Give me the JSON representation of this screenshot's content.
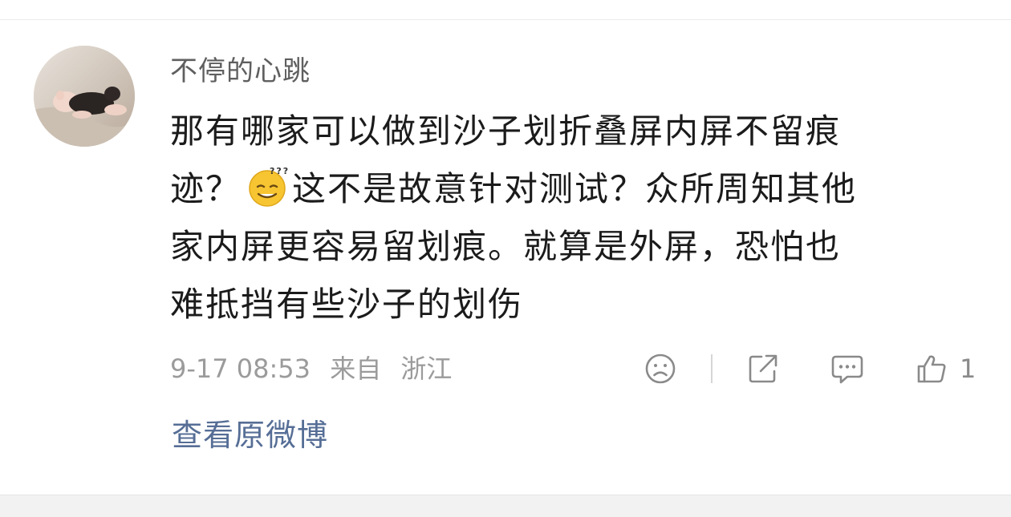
{
  "comment": {
    "username": "不停的心跳",
    "content_lines": {
      "line1": "那有哪家可以做到沙子划折叠屏内屏不留痕",
      "line2_pre": "迹？",
      "line2_post": "这不是故意针对测试？众所周知其他",
      "line3": "家内屏更容易留划痕。就算是外屏，恐怕也",
      "line4": "难抵挡有些沙子的划伤"
    },
    "emoji": "thinking-sleepy-emoji",
    "timestamp": "9-17 08:53",
    "source_prefix": "来自",
    "location": "浙江",
    "like_count": "1"
  },
  "actions": {
    "dislike_icon": "sad-face-icon",
    "share_icon": "share-icon",
    "comment_icon": "comment-icon",
    "like_icon": "thumbs-up-icon"
  },
  "footer": {
    "view_original": "查看原微博"
  },
  "colors": {
    "link": "#566e96",
    "meta": "#9b9b9b",
    "text": "#1b1b1b"
  }
}
